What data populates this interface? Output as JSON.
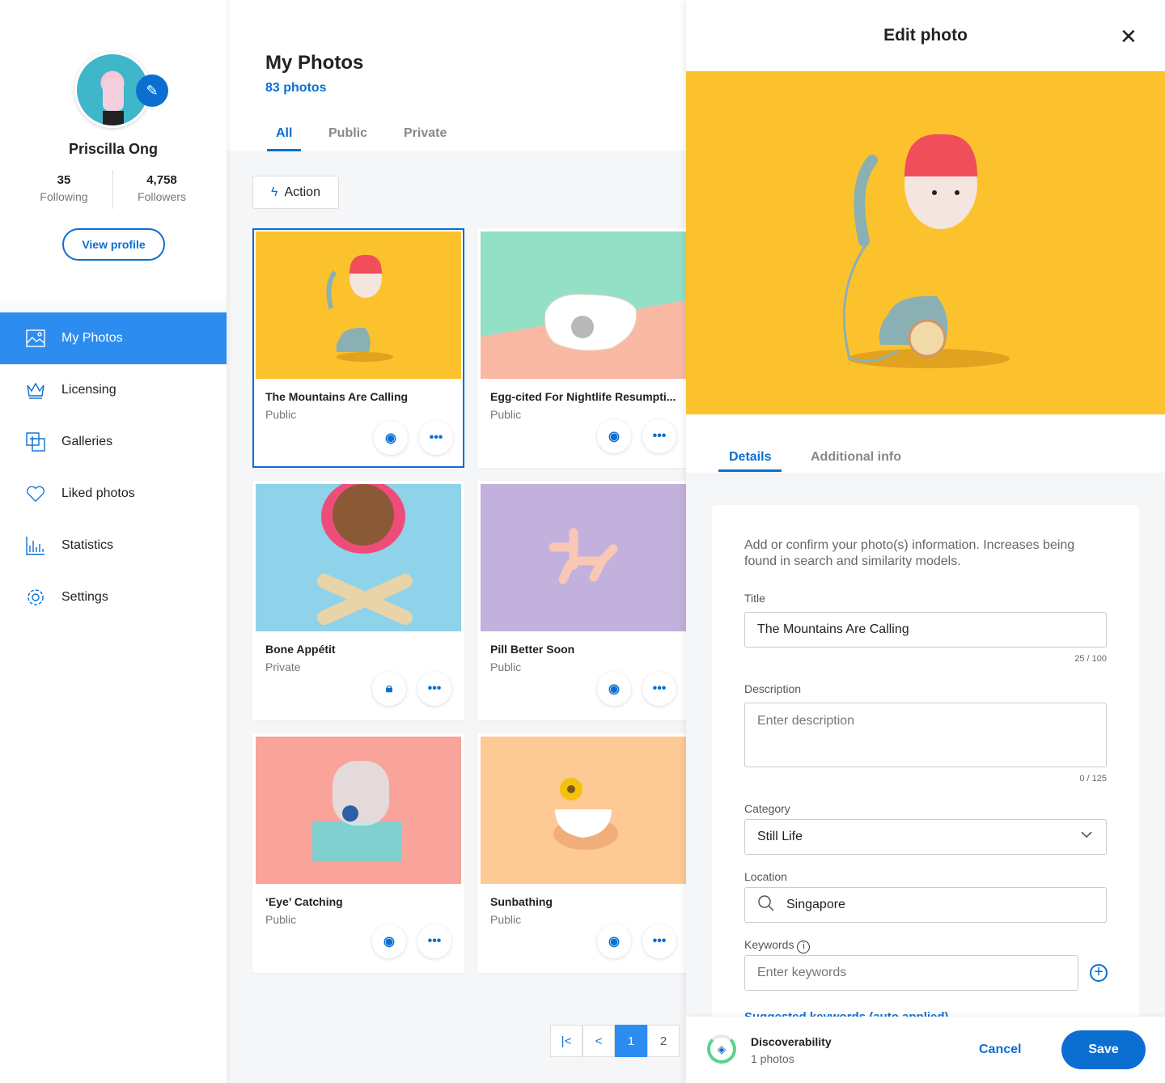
{
  "profile": {
    "name": "Priscilla Ong",
    "following_count": "35",
    "following_label": "Following",
    "followers_count": "4,758",
    "followers_label": "Followers",
    "view_profile": "View profile"
  },
  "sidebar": {
    "items": [
      {
        "label": "My Photos",
        "icon": "image-icon",
        "active": true
      },
      {
        "label": "Licensing",
        "icon": "crown-icon"
      },
      {
        "label": "Galleries",
        "icon": "gallery-add-icon"
      },
      {
        "label": "Liked photos",
        "icon": "heart-icon"
      },
      {
        "label": "Statistics",
        "icon": "bar-chart-icon"
      },
      {
        "label": "Settings",
        "icon": "gear-icon"
      }
    ]
  },
  "main": {
    "title": "My Photos",
    "count": "83 photos",
    "tabs": [
      {
        "label": "All",
        "active": true
      },
      {
        "label": "Public"
      },
      {
        "label": "Private"
      }
    ],
    "action_label": "Action",
    "photos": [
      {
        "title": "The Mountains Are Calling",
        "status": "Public",
        "bg": "#fcc22d",
        "selected": true
      },
      {
        "title": "Egg-cited For Nightlife Resumpti...",
        "status": "Public",
        "bg": "#93e0c6"
      },
      {
        "title": "Bone Appétit",
        "status": "Private",
        "bg": "#8fd3ea"
      },
      {
        "title": "Pill Better Soon",
        "status": "Public",
        "bg": "#c2b0dd"
      },
      {
        "title": "‘Eye’ Catching",
        "status": "Public",
        "bg": "#f9a39a"
      },
      {
        "title": "Sunbathing",
        "status": "Public",
        "bg": "#fdc994"
      }
    ],
    "pagination": {
      "pages": [
        "1",
        "2"
      ],
      "current": "1"
    }
  },
  "panel": {
    "title": "Edit photo",
    "tabs": [
      {
        "label": "Details",
        "active": true
      },
      {
        "label": "Additional info"
      }
    ],
    "intro": "Add or confirm your photo(s) information. Increases being found in search and similarity models.",
    "title_label": "Title",
    "title_value": "The Mountains Are Calling",
    "title_count": "25 / 100",
    "description_label": "Description",
    "description_placeholder": "Enter description",
    "description_count": "0 / 125",
    "category_label": "Category",
    "category_value": "Still Life",
    "location_label": "Location",
    "location_value": "Singapore",
    "keywords_label": "Keywords",
    "keywords_placeholder": "Enter keywords",
    "suggested_label": "Suggested keywords (auto applied)",
    "discoverability_label": "Discoverability",
    "discoverability_sub": "1 photos",
    "discoverability_progress": 0.85,
    "cancel": "Cancel",
    "save": "Save"
  },
  "colors": {
    "primary": "#0b6fd1",
    "active_nav": "#2d8cf0",
    "photo_bg": "#fcc22d"
  }
}
